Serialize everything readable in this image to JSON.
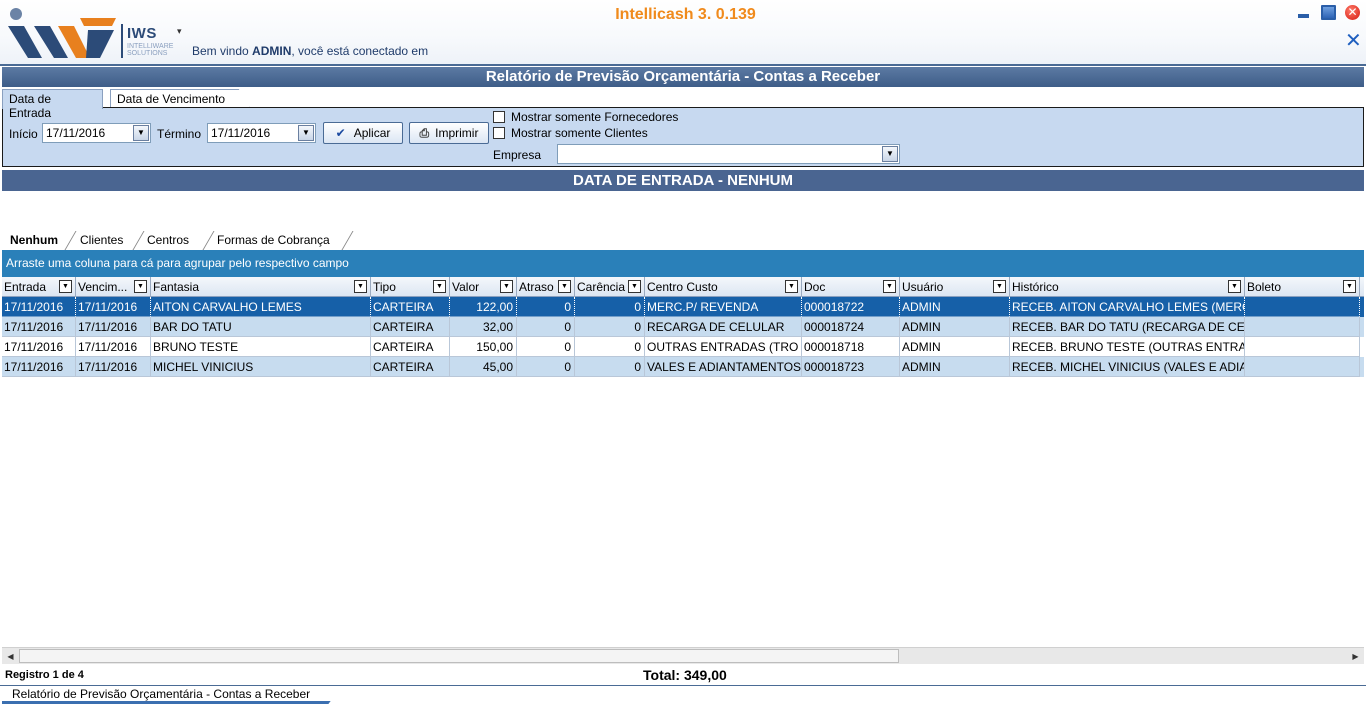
{
  "app": {
    "title": "Intellicash 3. 0.139",
    "logo_text": "IWS",
    "logo_sub": "INTELLIWARE SOLUTIONS",
    "menu_arrow": "▾",
    "welcome_prefix": "Bem vindo ",
    "welcome_user": "ADMIN",
    "welcome_suffix": ", você está conectado em",
    "close_icon": "✕",
    "window_close": "✕"
  },
  "report": {
    "title": "Relatório de Previsão Orçamentária - Contas a Receber"
  },
  "filter_tabs": [
    {
      "label": "Data de Entrada",
      "active": true
    },
    {
      "label": "Data de Vencimento",
      "active": false
    }
  ],
  "filter": {
    "inicio_label": "Início",
    "inicio_value": "17/11/2016",
    "termino_label": "Término",
    "termino_value": "17/11/2016",
    "aplicar_label": "Aplicar",
    "imprimir_label": "Imprimir",
    "mostrar_fornecedores": "Mostrar somente Fornecedores",
    "mostrar_clientes": "Mostrar somente Clientes",
    "empresa_label": "Empresa",
    "empresa_value": "",
    "combo_arrow": "▼"
  },
  "data_section": {
    "title": "DATA DE ENTRADA - NENHUM"
  },
  "group_tabs": [
    {
      "label": "Nenhum",
      "active": true
    },
    {
      "label": "Clientes",
      "active": false
    },
    {
      "label": "Centros",
      "active": false
    },
    {
      "label": "Formas de Cobrança",
      "active": false
    }
  ],
  "drag_hint": "Arraste uma coluna para cá para agrupar pelo respectivo campo",
  "grid": {
    "columns": [
      "Entrada",
      "Vencim...",
      "Fantasia",
      "Tipo",
      "Valor",
      "Atraso",
      "Carência",
      "Centro Custo",
      "Doc",
      "Usuário",
      "Histórico",
      "Boleto"
    ],
    "rows": [
      [
        "17/11/2016",
        "17/11/2016",
        "AITON CARVALHO LEMES",
        "CARTEIRA",
        "122,00",
        "0",
        "0",
        "MERC.P/ REVENDA",
        "000018722",
        "ADMIN",
        "RECEB. AITON CARVALHO LEMES (MERC",
        ""
      ],
      [
        "17/11/2016",
        "17/11/2016",
        "BAR DO TATU",
        "CARTEIRA",
        "32,00",
        "0",
        "0",
        "RECARGA DE CELULAR",
        "000018724",
        "ADMIN",
        "RECEB. BAR DO TATU (RECARGA DE CEL",
        ""
      ],
      [
        "17/11/2016",
        "17/11/2016",
        "BRUNO TESTE",
        "CARTEIRA",
        "150,00",
        "0",
        "0",
        "OUTRAS ENTRADAS (TRO",
        "000018718",
        "ADMIN",
        "RECEB. BRUNO TESTE (OUTRAS ENTRAI",
        ""
      ],
      [
        "17/11/2016",
        "17/11/2016",
        "MICHEL VINICIUS",
        "CARTEIRA",
        "45,00",
        "0",
        "0",
        "VALES E ADIANTAMENTOS",
        "000018723",
        "ADMIN",
        "RECEB. MICHEL VINICIUS (VALES E ADIA",
        ""
      ]
    ]
  },
  "footer": {
    "registro": "Registro 1 de 4",
    "total": "Total: 349,00"
  },
  "bottom_tab": "Relatório de Previsão Orçamentária - Contas a Receber",
  "colors": {
    "accent_orange": "#f08a1c",
    "header_blue": "#4a6591",
    "selected_row": "#1660a8",
    "alt_row": "#c7dcef",
    "drag_bar": "#2a80b9"
  }
}
